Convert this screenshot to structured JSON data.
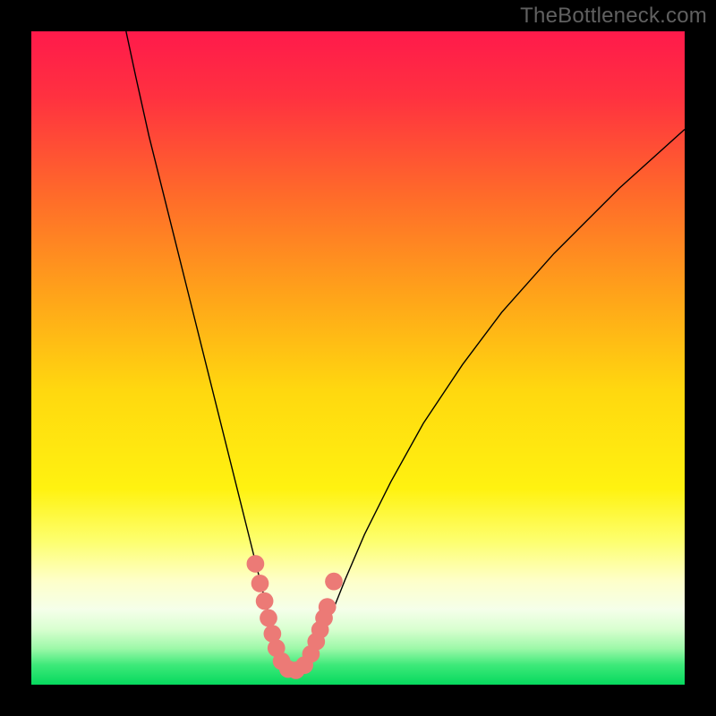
{
  "watermark": "TheBottleneck.com",
  "chart_data": {
    "type": "line",
    "title": "",
    "xlabel": "",
    "ylabel": "",
    "xlim": [
      0,
      100
    ],
    "ylim": [
      0,
      100
    ],
    "gradient_stops": [
      {
        "offset": 0.0,
        "color": "#ff1a4b"
      },
      {
        "offset": 0.1,
        "color": "#ff3140"
      },
      {
        "offset": 0.25,
        "color": "#ff6a2a"
      },
      {
        "offset": 0.4,
        "color": "#ffa21a"
      },
      {
        "offset": 0.55,
        "color": "#ffd80f"
      },
      {
        "offset": 0.7,
        "color": "#fff210"
      },
      {
        "offset": 0.78,
        "color": "#fdff6e"
      },
      {
        "offset": 0.84,
        "color": "#feffc8"
      },
      {
        "offset": 0.885,
        "color": "#f5ffea"
      },
      {
        "offset": 0.915,
        "color": "#d9ffd0"
      },
      {
        "offset": 0.945,
        "color": "#9cf8a8"
      },
      {
        "offset": 0.97,
        "color": "#3de979"
      },
      {
        "offset": 1.0,
        "color": "#06d95e"
      }
    ],
    "series": [
      {
        "name": "main-curve",
        "color": "#000000",
        "x": [
          14.5,
          16,
          18,
          20,
          22,
          24,
          26,
          28,
          30,
          32,
          34,
          36,
          37.5,
          38.5,
          39.5,
          40.5,
          42,
          44,
          46,
          48,
          51,
          55,
          60,
          66,
          72,
          80,
          90,
          100
        ],
        "y": [
          100,
          93,
          84,
          76,
          68,
          60,
          52,
          44,
          36,
          28,
          20,
          12,
          7,
          4,
          2.2,
          2.2,
          3.8,
          7,
          11,
          16,
          23,
          31,
          40,
          49,
          57,
          66,
          76,
          85
        ]
      },
      {
        "name": "marker-dots",
        "color": "#ec7a76",
        "type": "scatter",
        "x": [
          34.3,
          35.0,
          35.7,
          36.3,
          36.9,
          37.5,
          38.3,
          39.3,
          40.5,
          41.8,
          42.8,
          43.6,
          44.2,
          44.8,
          45.3,
          46.3
        ],
        "y": [
          18.5,
          15.5,
          12.8,
          10.2,
          7.8,
          5.6,
          3.6,
          2.4,
          2.2,
          3.0,
          4.7,
          6.6,
          8.4,
          10.2,
          11.9,
          15.8
        ]
      }
    ]
  }
}
